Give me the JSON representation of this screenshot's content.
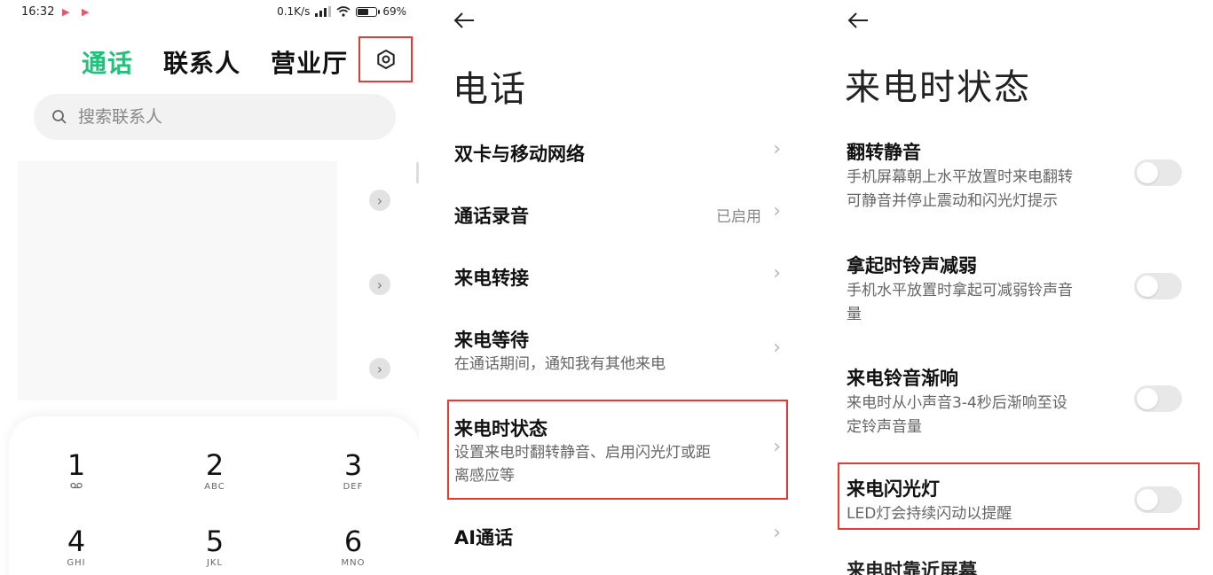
{
  "phone_home": {
    "status": {
      "time": "16:32",
      "speed": "0.1K/s",
      "battery": "69%",
      "battery_level": 0.69
    },
    "tabs": [
      {
        "label": "通话"
      },
      {
        "label": "联系人"
      },
      {
        "label": "营业厅"
      }
    ],
    "search": {
      "placeholder": "搜索联系人"
    },
    "keypad": [
      {
        "num": "1",
        "letters": ""
      },
      {
        "num": "2",
        "letters": "ABC"
      },
      {
        "num": "3",
        "letters": "DEF"
      },
      {
        "num": "4",
        "letters": "GHI"
      },
      {
        "num": "5",
        "letters": "JKL"
      },
      {
        "num": "6",
        "letters": "MNO"
      }
    ],
    "icons": {
      "settings": "settings-icon",
      "search": "search-icon",
      "voicemail": "voicemail-icon"
    },
    "accent_color": "#22c07a"
  },
  "phone_settings": {
    "title": "电话",
    "items": [
      {
        "title": "双卡与移动网络",
        "subtitle": "",
        "status": ""
      },
      {
        "title": "通话录音",
        "subtitle": "",
        "status": "已启用"
      },
      {
        "title": "来电转接",
        "subtitle": "",
        "status": ""
      },
      {
        "title": "来电等待",
        "subtitle": "在通话期间，通知我有其他来电",
        "status": ""
      },
      {
        "title": "来电时状态",
        "subtitle_line1": "设置来电时翻转静音、启用闪光灯或距",
        "subtitle_line2": "离感应等",
        "status": ""
      },
      {
        "title": "AI通话",
        "subtitle": "",
        "status": ""
      }
    ]
  },
  "incoming_state": {
    "title": "来电时状态",
    "items": [
      {
        "title": "翻转静音",
        "sub_line1": "手机屏幕朝上水平放置时来电翻转",
        "sub_line2": "可静音并停止震动和闪光灯提示",
        "enabled": false
      },
      {
        "title": "拿起时铃声减弱",
        "sub_line1": "手机水平放置时拿起可减弱铃声音",
        "sub_line2": "量",
        "enabled": false
      },
      {
        "title": "来电铃音渐响",
        "sub_line1": "来电时从小声音3-4秒后渐响至设",
        "sub_line2": "定铃声音量",
        "enabled": false
      },
      {
        "title": "来电闪光灯",
        "sub_line1": "LED灯会持续闪动以提醒",
        "sub_line2": "",
        "enabled": false
      }
    ],
    "partial_next": "来电时靠近屏幕"
  },
  "colors": {
    "highlight_box": "#e53935",
    "toggle_off": "#e8e8e8"
  }
}
